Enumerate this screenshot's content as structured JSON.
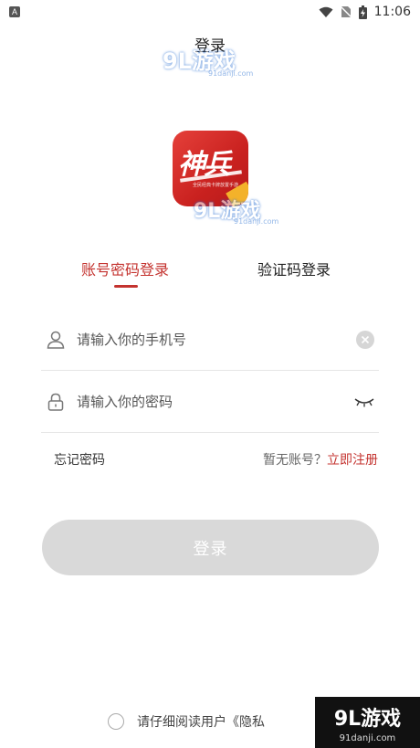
{
  "status_bar": {
    "left_icon": "A",
    "time": "11:06",
    "icons": [
      "wifi-icon",
      "no-sim-icon",
      "battery-charging-icon"
    ]
  },
  "header": {
    "title": "登录"
  },
  "logo": {
    "text": "神兵",
    "subtext": "全民经典卡牌放置手游"
  },
  "tabs": [
    {
      "label": "账号密码登录",
      "active": true
    },
    {
      "label": "验证码登录",
      "active": false
    }
  ],
  "form": {
    "phone": {
      "placeholder": "请输入你的手机号",
      "value": ""
    },
    "password": {
      "placeholder": "请输入你的密码",
      "value": ""
    },
    "forgot_label": "忘记密码",
    "no_account_label": "暂无账号？",
    "register_label": "立即注册",
    "login_button_label": "登录"
  },
  "agreement": {
    "text": "请仔细阅读用户《隐私"
  },
  "watermarks": {
    "mark": "9L游戏",
    "url": "91danji.com"
  },
  "colors": {
    "accent": "#c4332f",
    "button_disabled": "#d9d9d9",
    "divider": "#e6e6e6"
  }
}
